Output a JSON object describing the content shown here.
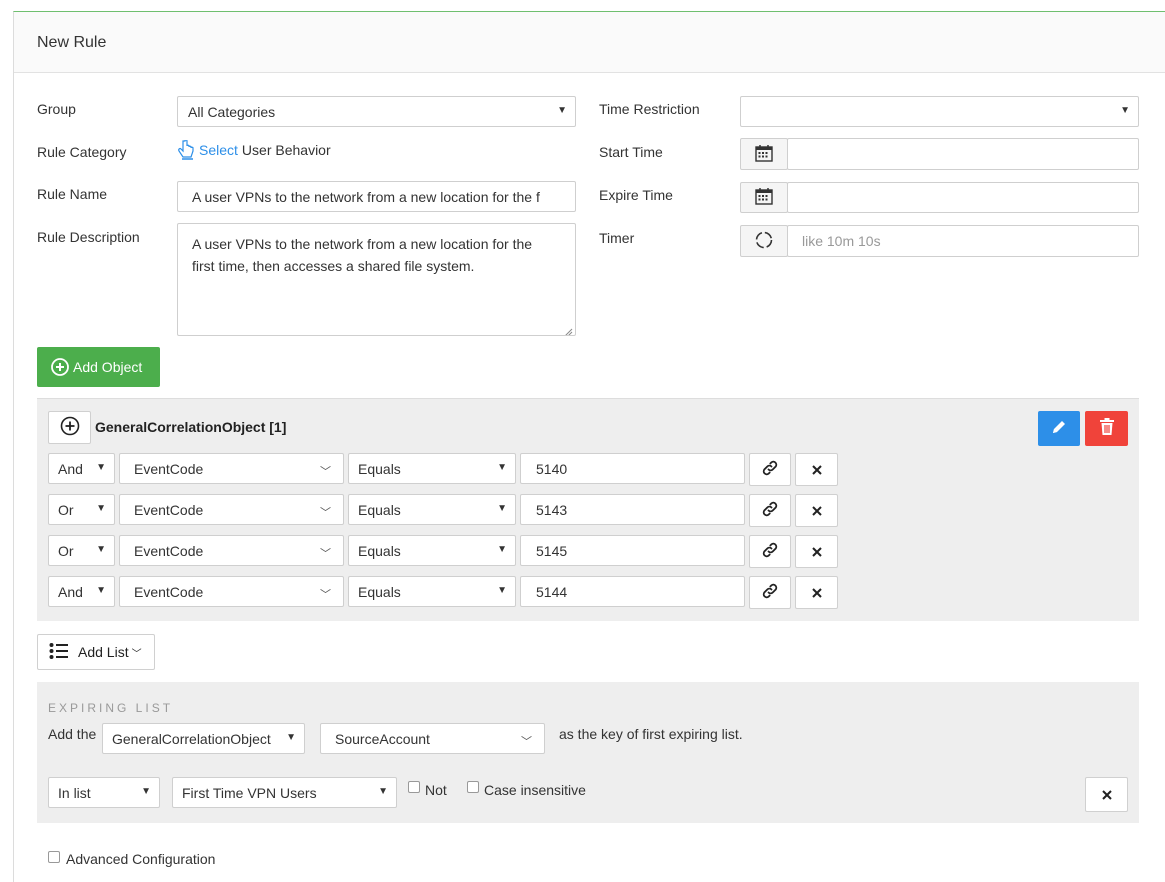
{
  "panel": {
    "title": "New Rule"
  },
  "form": {
    "group_label": "Group",
    "group_value": "All Categories",
    "rule_category_label": "Rule Category",
    "select_link": "Select",
    "category_value": "User Behavior",
    "rule_name_label": "Rule Name",
    "rule_name_value": "A user VPNs to the network from a new location for the f",
    "rule_description_label": "Rule Description",
    "rule_description_line1": "A user VPNs to the network from a new location for the",
    "rule_description_line2": "first time, then accesses a shared file system.",
    "time_restriction_label": "Time Restriction",
    "time_restriction_value": "",
    "start_time_label": "Start Time",
    "start_time_value": "",
    "expire_time_label": "Expire Time",
    "expire_time_value": "",
    "timer_label": "Timer",
    "timer_placeholder": "like 10m 10s"
  },
  "add_object_label": "Add Object",
  "object": {
    "title": "GeneralCorrelationObject [1]",
    "conditions": [
      {
        "logic": "And",
        "field": "EventCode",
        "operator": "Equals",
        "value": "5140"
      },
      {
        "logic": "Or",
        "field": "EventCode",
        "operator": "Equals",
        "value": "5143"
      },
      {
        "logic": "Or",
        "field": "EventCode",
        "operator": "Equals",
        "value": "5145"
      },
      {
        "logic": "And",
        "field": "EventCode",
        "operator": "Equals",
        "value": "5144"
      }
    ]
  },
  "add_list_label": "Add List",
  "expiring": {
    "heading": "EXPIRING LIST",
    "prefix": "Add the",
    "object_value": "GeneralCorrelationObject",
    "key_value": "SourceAccount",
    "suffix": "as the key of first expiring list.",
    "in_list_value": "In list",
    "list_value": "First Time VPN Users",
    "not_label": "Not",
    "case_label": "Case insensitive"
  },
  "advanced_label": "Advanced Configuration",
  "colors": {
    "green": "#4cae4c",
    "blue": "#2d8fe8",
    "red": "#f0433a"
  }
}
